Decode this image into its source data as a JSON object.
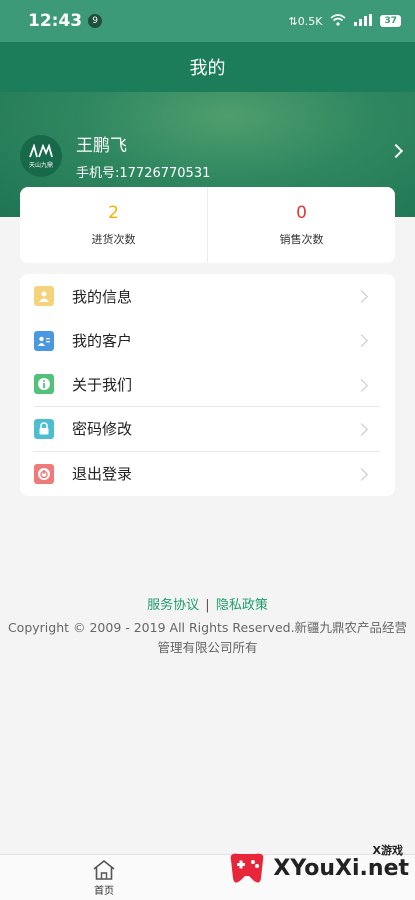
{
  "status": {
    "time": "12:43",
    "notif_count": "9",
    "speed": "0.5K",
    "battery": "37"
  },
  "header": {
    "title": "我的"
  },
  "profile": {
    "name": "王鹏飞",
    "phone": "手机号:17726770531",
    "logo_text": "天山九鼎"
  },
  "stats": [
    {
      "value": "2",
      "label": "进货次数"
    },
    {
      "value": "0",
      "label": "销售次数"
    }
  ],
  "menu": [
    {
      "label": "我的信息"
    },
    {
      "label": "我的客户"
    },
    {
      "label": "关于我们"
    },
    {
      "label": "密码修改"
    },
    {
      "label": "退出登录"
    }
  ],
  "footer": {
    "service": "服务协议",
    "separator": "|",
    "privacy": "隐私政策",
    "copyright": "Copyright © 2009 - 2019 All Rights Reserved.新疆九鼎农产品经营管理有限公司所有"
  },
  "tabbar": {
    "home": "首页"
  },
  "watermark": {
    "site": "XYouXi.net",
    "tag": "X游戏"
  },
  "colors": {
    "brand": "#1b7d5a",
    "status": "#3d9a78",
    "link": "#1e9e6a"
  }
}
